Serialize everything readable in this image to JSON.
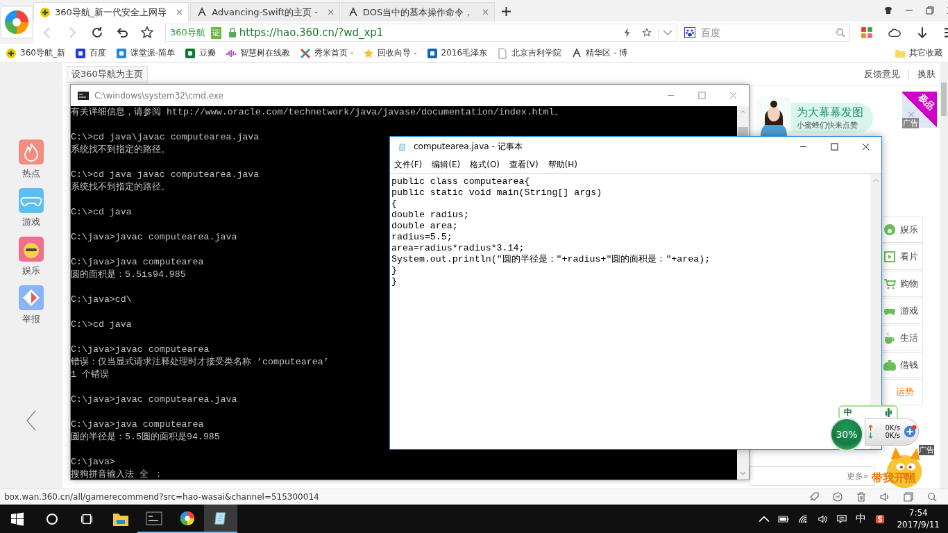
{
  "browser": {
    "tabs": [
      {
        "title": "360导航_新一代安全上网导",
        "selected": true,
        "kind": "plus"
      },
      {
        "title": "Advancing-Swift的主页 -",
        "selected": false,
        "kind": "blog"
      },
      {
        "title": "DOS当中的基本操作命令，",
        "selected": false,
        "kind": "blog"
      }
    ],
    "nav": {
      "back": {
        "disabled": true
      },
      "forward": {
        "disabled": true
      }
    },
    "address": {
      "badge": "360导航",
      "cert": "证",
      "url": "https://hao.360.cn/?wd_xp1"
    },
    "search": {
      "placeholder": "百度"
    },
    "bookmarks": [
      {
        "label": "360导航_新",
        "kind": "plus"
      },
      {
        "label": "百度",
        "kind": "paw"
      },
      {
        "label": "课堂派-简单",
        "kind": "ketang"
      },
      {
        "label": "豆瓣",
        "kind": "douban"
      },
      {
        "label": "智慧树在线教",
        "kind": "bars"
      },
      {
        "label": "秀米首页 -",
        "kind": "cross"
      },
      {
        "label": "回收向导 -",
        "kind": "star"
      },
      {
        "label": "2016毛泽东",
        "kind": "d"
      },
      {
        "label": "北京吉利学院",
        "kind": "page"
      },
      {
        "label": "精华区 - 博",
        "kind": "blog"
      }
    ],
    "other_bookmarks": "其它收藏",
    "status_url": "box.wan.360.cn/all/gamerecommend?src=hao-wasai&channel=515300014"
  },
  "page": {
    "set_home": "设360导航为主页",
    "feedback": "反馈意见",
    "skin": "换肤",
    "sidebar": [
      {
        "label": "热点",
        "kind": "hot"
      },
      {
        "label": "游戏",
        "kind": "game"
      },
      {
        "label": "娱乐",
        "kind": "fun"
      },
      {
        "label": "举报",
        "kind": "report"
      }
    ],
    "ad": {
      "title": "为大幕幕发图",
      "subtitle": "小蜜蜂们快来点赞",
      "corner": "极品",
      "tag": "广告"
    },
    "categories": [
      {
        "label": "娱乐",
        "kind": "fun"
      },
      {
        "label": "看片",
        "kind": "video"
      },
      {
        "label": "购物",
        "kind": "shop"
      },
      {
        "label": "游戏",
        "kind": "game"
      },
      {
        "label": "生活",
        "kind": "life"
      },
      {
        "label": "借钱",
        "kind": "money"
      },
      {
        "label": "运势",
        "kind": "fortune"
      }
    ],
    "more": "更多»",
    "game_ad": {
      "title": "带我开黑",
      "tag": "广告"
    }
  },
  "speed_widget": {
    "char": "中",
    "percent": "30%",
    "up": "0K/s",
    "down": "0K/s"
  },
  "cmd": {
    "title": "C:\\windows\\system32\\cmd.exe",
    "blocks": [
      [
        "有关详细信息，请参阅 http://www.oracle.com/technetwork/java/javase/documentation/index.html。"
      ],
      [
        "C:\\>cd java\\javac computearea.java",
        "系统找不到指定的路径。"
      ],
      [
        "C:\\>cd java javac computearea.java",
        "系统找不到指定的路径。"
      ],
      [
        "C:\\>cd java"
      ],
      [
        "C:\\java>javac computearea.java"
      ],
      [
        "C:\\java>java computearea",
        "圆的面积是：5.5is94.985"
      ],
      [
        "C:\\java>cd\\"
      ],
      [
        "C:\\>cd java"
      ],
      [
        "C:\\java>javac computearea",
        "错误：仅当显式请求注释处理时才接受类名称 ’computearea’",
        "1 个错误"
      ],
      [
        "C:\\java>javac computearea.java"
      ],
      [
        "C:\\java>java computearea",
        "圆的半径是：5.5圆的面积是94.985"
      ],
      [
        "C:\\java>",
        "搜狗拼音输入法 全 ："
      ]
    ]
  },
  "notepad": {
    "title": "computearea.java - 记事本",
    "menu": [
      "文件(F)",
      "编辑(E)",
      "格式(O)",
      "查看(V)",
      "帮助(H)"
    ],
    "lines": [
      "public class computearea{",
      "public static void main(String[] args)",
      "{",
      "double radius;",
      "double area;",
      "radius=5.5;",
      "area=radius*radius*3.14;",
      "System.out.println(\"圆的半径是：\"+radius+\"圆的面积是：\"+area);",
      "}",
      "}"
    ]
  },
  "taskbar": {
    "apps": [
      {
        "kind": "explorer",
        "running": false,
        "selected": false
      },
      {
        "kind": "cmd",
        "running": true,
        "selected": false
      },
      {
        "kind": "browser",
        "running": true,
        "selected": false
      },
      {
        "kind": "notepad",
        "running": true,
        "selected": true
      }
    ],
    "ime": "中",
    "time": "7:54",
    "date": "2017/9/11"
  }
}
